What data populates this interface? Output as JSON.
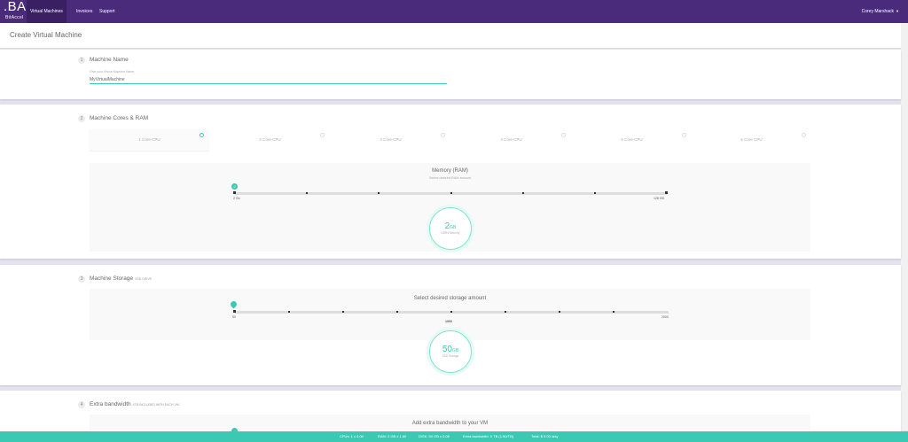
{
  "brand": {
    "logo_big": ".BA",
    "logo_small": "BitAccel"
  },
  "nav": {
    "items": [
      {
        "label": "Virtual Machines",
        "active": true
      },
      {
        "label": "Invoices"
      },
      {
        "label": "Support"
      }
    ]
  },
  "user": {
    "name": "Corey Marshack"
  },
  "page": {
    "title": "Create Virtual Machine"
  },
  "step1": {
    "number": "1",
    "title": "Machine Name",
    "input_label": "Give your Virtual Machine Name",
    "input_value": "MyVirtualMachine"
  },
  "step2": {
    "number": "2",
    "title": "Machine Cores & RAM",
    "cpu_options": [
      {
        "label": "1 Core CPU",
        "selected": true
      },
      {
        "label": "2 Core CPU"
      },
      {
        "label": "3 Core CPU"
      },
      {
        "label": "4 Core CPU"
      },
      {
        "label": "5 Core CPU"
      },
      {
        "label": "6 Core CPU"
      }
    ],
    "ram": {
      "title": "Memory (RAM)",
      "subtitle": "Select desired RAM amount",
      "min_label": "2 Gb",
      "max_label": "128 GB",
      "handle_label": "2",
      "value": "2",
      "unit": "GB",
      "caption": "DDR4 Memory",
      "level": 0
    }
  },
  "step3": {
    "number": "3",
    "title": "Machine Storage",
    "note": "SSD DRIVE",
    "storage": {
      "title": "Select desired storage amount",
      "min_label": "50",
      "mid_label": "1000",
      "max_label": "2000",
      "value": "50",
      "unit": "GB",
      "caption": "SSD Storage",
      "level": 0
    }
  },
  "step4": {
    "number": "4",
    "title": "Extra bandwidth",
    "note": "4TB INCLUDED WITH EACH VM",
    "subtitle": "Add extra bandwidth to your VM"
  },
  "footer": {
    "items": [
      "CPUs: 1 x 4.00",
      "RAM: 2 GB x 1.50",
      "DISK: 50 GB x 0.05",
      "Extra bandwidth: 0 TB (1.50/TB)",
      "Total: $ 9.00 /day"
    ]
  },
  "colors": {
    "brand_purple": "#4a2a7a",
    "accent_teal": "#3cc9b4",
    "background": "#e4e2ef"
  }
}
